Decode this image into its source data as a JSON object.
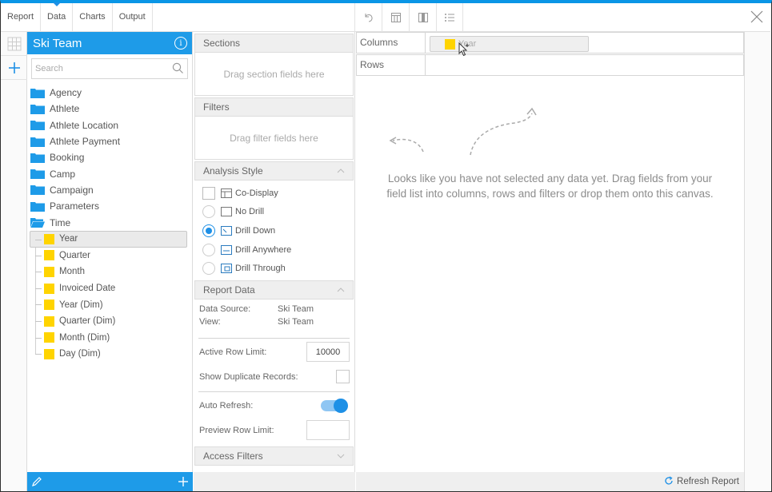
{
  "toolbar": {
    "tabs": [
      {
        "label": "Report",
        "active": false
      },
      {
        "label": "Data",
        "active": true
      },
      {
        "label": "Charts",
        "active": false
      },
      {
        "label": "Output",
        "active": false
      }
    ],
    "tools": [
      "undo-icon",
      "table-layout-icon",
      "column-layout-icon",
      "list-settings-icon"
    ],
    "close": "close-icon"
  },
  "fields_panel": {
    "title": "Ski Team",
    "search_placeholder": "Search",
    "folders": [
      "Agency",
      "Athlete",
      "Athlete Location",
      "Athlete Payment",
      "Booking",
      "Camp",
      "Campaign",
      "Parameters",
      "Time"
    ],
    "time_fields": [
      {
        "label": "Year",
        "selected": true
      },
      {
        "label": "Quarter",
        "selected": false
      },
      {
        "label": "Month",
        "selected": false
      },
      {
        "label": "Invoiced Date",
        "selected": false
      },
      {
        "label": "Year (Dim)",
        "selected": false
      },
      {
        "label": "Quarter (Dim)",
        "selected": false
      },
      {
        "label": "Month (Dim)",
        "selected": false
      },
      {
        "label": "Day (Dim)",
        "selected": false
      }
    ]
  },
  "config": {
    "sections": {
      "title": "Sections",
      "placeholder": "Drag section fields here"
    },
    "filters": {
      "title": "Filters",
      "placeholder": "Drag filter fields here"
    },
    "analysis_style": {
      "title": "Analysis Style",
      "co_display": "Co-Display",
      "options": [
        {
          "label": "No Drill",
          "selected": false
        },
        {
          "label": "Drill Down",
          "selected": true
        },
        {
          "label": "Drill Anywhere",
          "selected": false
        },
        {
          "label": "Drill Through",
          "selected": false
        }
      ]
    },
    "report_data": {
      "title": "Report Data",
      "data_source_label": "Data Source:",
      "data_source_value": "Ski Team",
      "view_label": "View:",
      "view_value": "Ski Team",
      "active_row_limit_label": "Active Row Limit:",
      "active_row_limit_value": "10000",
      "show_duplicates_label": "Show Duplicate Records:",
      "auto_refresh_label": "Auto Refresh:",
      "auto_refresh_on": true,
      "preview_row_limit_label": "Preview Row Limit:",
      "preview_row_limit_value": ""
    },
    "access_filters": {
      "title": "Access Filters"
    }
  },
  "canvas": {
    "columns_label": "Columns",
    "rows_label": "Rows",
    "column_chip": "Year",
    "empty_message": "Looks like you have not selected any data yet. Drag fields from your field list into columns, rows and filters or drop them onto this canvas.",
    "refresh_label": "Refresh Report"
  },
  "colors": {
    "accent": "#1e9be8",
    "field_yellow": "#ffd400"
  }
}
